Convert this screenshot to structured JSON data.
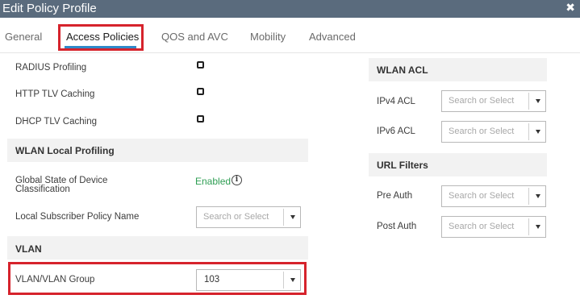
{
  "window": {
    "title": "Edit Policy Profile",
    "close_glyph": "✖"
  },
  "tabs": [
    {
      "label": "General",
      "active": false
    },
    {
      "label": "Access Policies",
      "active": true
    },
    {
      "label": "QOS and AVC",
      "active": false
    },
    {
      "label": "Mobility",
      "active": false
    },
    {
      "label": "Advanced",
      "active": false
    }
  ],
  "left": {
    "radius_profiling": {
      "label": "RADIUS Profiling",
      "checked": false
    },
    "http_tlv_caching": {
      "label": "HTTP TLV Caching",
      "checked": false
    },
    "dhcp_tlv_caching": {
      "label": "DHCP TLV Caching",
      "checked": false
    },
    "wlan_local_profiling": {
      "title": "WLAN Local Profiling",
      "global_state_label": "Global State of Device Classification",
      "global_state_value": "Enabled",
      "info_glyph": "i",
      "local_subscriber_label": "Local Subscriber Policy Name",
      "local_subscriber_placeholder": "Search or Select"
    },
    "vlan": {
      "title": "VLAN",
      "vlan_group_label": "VLAN/VLAN Group",
      "vlan_group_value": "103"
    }
  },
  "right": {
    "wlan_acl": {
      "title": "WLAN ACL",
      "ipv4_label": "IPv4 ACL",
      "ipv4_placeholder": "Search or Select",
      "ipv6_label": "IPv6 ACL",
      "ipv6_placeholder": "Search or Select"
    },
    "url_filters": {
      "title": "URL Filters",
      "pre_auth_label": "Pre Auth",
      "pre_auth_placeholder": "Search or Select",
      "post_auth_label": "Post Auth",
      "post_auth_placeholder": "Search or Select"
    }
  },
  "colors": {
    "titlebar": "#5a6b7d",
    "highlight": "#d6232c",
    "tab_underline": "#2f89c9",
    "enabled_text": "#2e9e53",
    "section_bg": "#f2f2f2"
  }
}
